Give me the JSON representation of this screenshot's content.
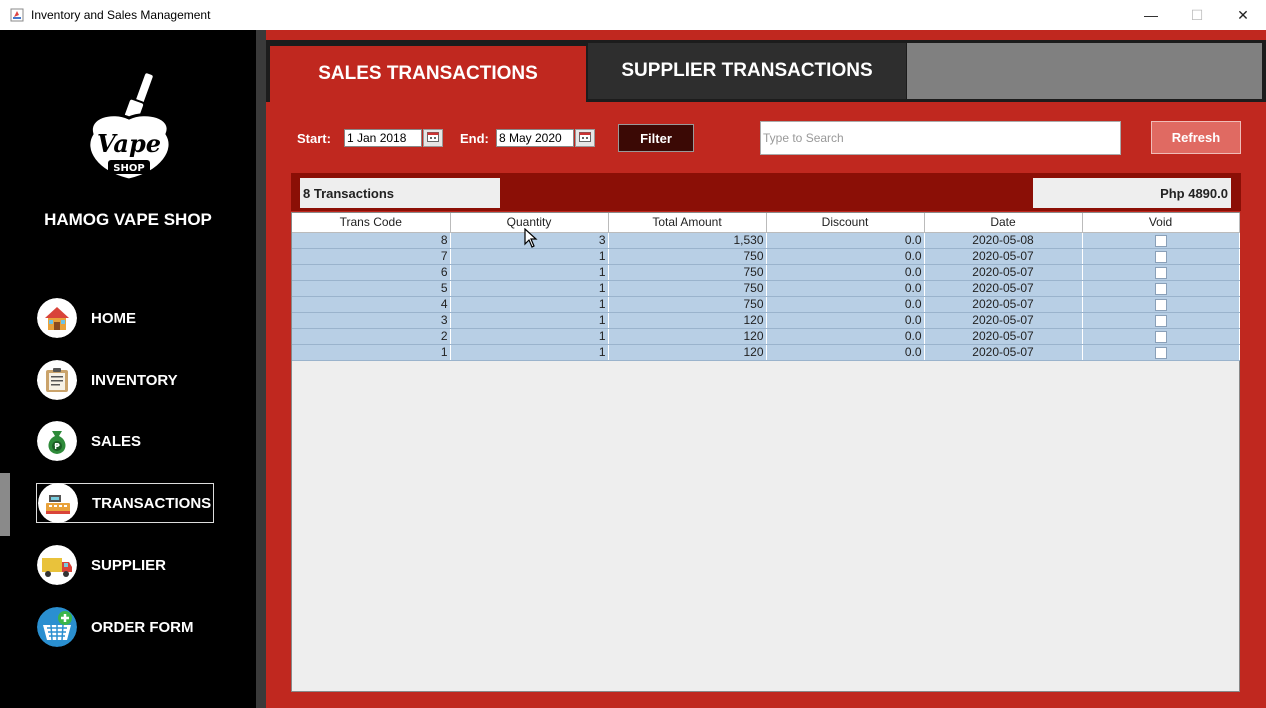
{
  "window": {
    "title": "Inventory and Sales Management",
    "minimize": "—",
    "maximize": "☐",
    "close": "✕"
  },
  "sidebar": {
    "logo_text": "Vape",
    "logo_subtext": "SHOP",
    "shop_name": "HAMOG VAPE SHOP",
    "items": [
      {
        "label": "HOME",
        "icon": "house-icon"
      },
      {
        "label": "INVENTORY",
        "icon": "clipboard-icon"
      },
      {
        "label": "SALES",
        "icon": "money-bag-icon"
      },
      {
        "label": "TRANSACTIONS",
        "icon": "cash-register-icon",
        "active": true
      },
      {
        "label": "SUPPLIER",
        "icon": "truck-icon"
      },
      {
        "label": "ORDER FORM",
        "icon": "basket-add-icon"
      }
    ]
  },
  "tabs": {
    "sales": "SALES TRANSACTIONS",
    "supplier": "SUPPLIER TRANSACTIONS"
  },
  "filters": {
    "start_label": "Start:",
    "start_value": "1 Jan 2018",
    "end_label": "End:",
    "end_value": "8 May 2020",
    "filter_button": "Filter",
    "search_placeholder": "Type to Search",
    "refresh_button": "Refresh"
  },
  "summary": {
    "count": "8 Transactions",
    "total": "Php 4890.0"
  },
  "table": {
    "columns": [
      "Trans Code",
      "Quantity",
      "Total Amount",
      "Discount",
      "Date",
      "Void"
    ],
    "rows": [
      {
        "code": "8",
        "qty": "3",
        "amount": "1,530",
        "discount": "0.0",
        "date": "2020-05-08"
      },
      {
        "code": "7",
        "qty": "1",
        "amount": "750",
        "discount": "0.0",
        "date": "2020-05-07"
      },
      {
        "code": "6",
        "qty": "1",
        "amount": "750",
        "discount": "0.0",
        "date": "2020-05-07"
      },
      {
        "code": "5",
        "qty": "1",
        "amount": "750",
        "discount": "0.0",
        "date": "2020-05-07"
      },
      {
        "code": "4",
        "qty": "1",
        "amount": "750",
        "discount": "0.0",
        "date": "2020-05-07"
      },
      {
        "code": "3",
        "qty": "1",
        "amount": "120",
        "discount": "0.0",
        "date": "2020-05-07"
      },
      {
        "code": "2",
        "qty": "1",
        "amount": "120",
        "discount": "0.0",
        "date": "2020-05-07"
      },
      {
        "code": "1",
        "qty": "1",
        "amount": "120",
        "discount": "0.0",
        "date": "2020-05-07"
      }
    ]
  }
}
